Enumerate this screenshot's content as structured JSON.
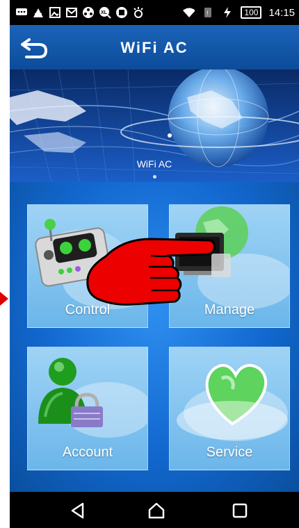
{
  "status_bar": {
    "battery_level": "100",
    "time": "14:15",
    "icons": [
      "message-icon",
      "photo-icon",
      "gallery-icon",
      "mail-icon",
      "film-icon",
      "xl-icon",
      "battery-saver-icon",
      "brightness-icon",
      "wifi-icon",
      "sim-icon",
      "charging-icon"
    ]
  },
  "header": {
    "title": "WiFi AC",
    "back_icon": "back-arrow-icon"
  },
  "banner": {
    "caption": "WiFi AC",
    "page_indicator": 1
  },
  "tiles": [
    {
      "label": "Control",
      "icon": "control-panel-icon"
    },
    {
      "label": "Manage",
      "icon": "devices-icon"
    },
    {
      "label": "Account",
      "icon": "user-lock-icon"
    },
    {
      "label": "Service",
      "icon": "heart-icon"
    }
  ],
  "navbar": {
    "icons": [
      "back-triangle-icon",
      "home-icon",
      "recents-icon"
    ]
  },
  "overlay": {
    "icon": "pointing-hand-icon",
    "color": "#e60000"
  }
}
